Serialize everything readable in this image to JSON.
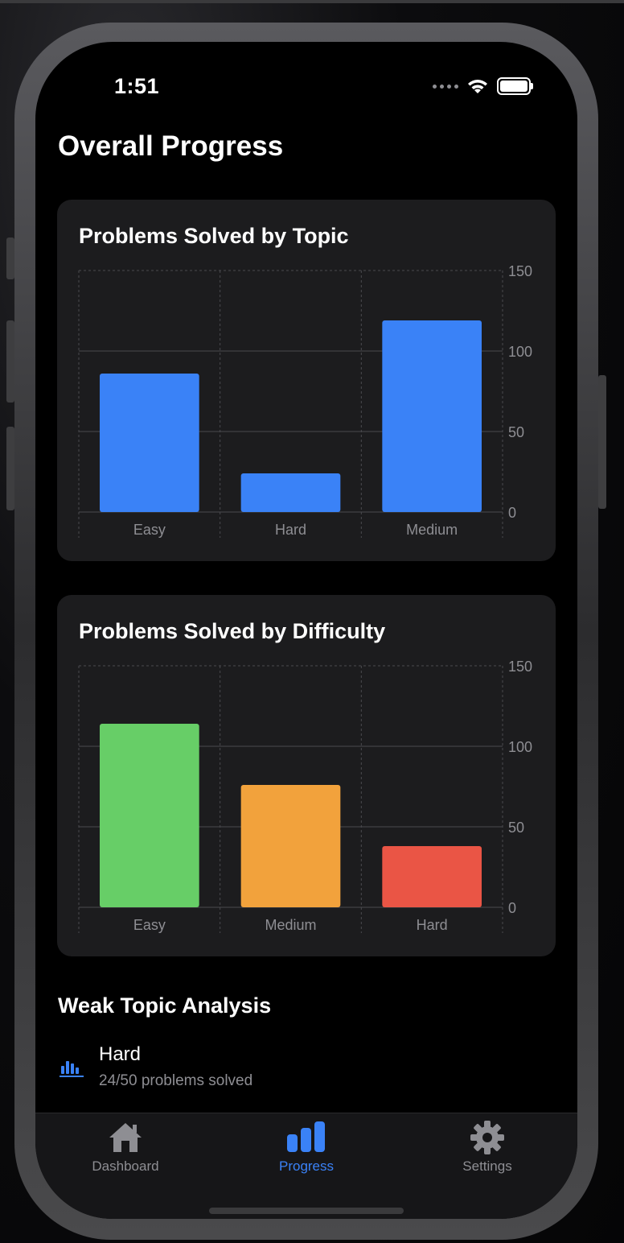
{
  "status_bar": {
    "time": "1:51"
  },
  "page_title": "Overall Progress",
  "topic_card": {
    "title": "Problems Solved by Topic"
  },
  "difficulty_card": {
    "title": "Problems Solved by Difficulty"
  },
  "chart_data": [
    {
      "type": "bar",
      "title": "Problems Solved by Topic",
      "categories": [
        "Easy",
        "Hard",
        "Medium"
      ],
      "values": [
        86,
        24,
        119
      ],
      "colors": [
        "#3a82f7",
        "#3a82f7",
        "#3a82f7"
      ],
      "ylim": [
        0,
        150
      ],
      "yticks": [
        0,
        50,
        100,
        150
      ],
      "y_axis_side": "right",
      "grid": true
    },
    {
      "type": "bar",
      "title": "Problems Solved by Difficulty",
      "categories": [
        "Easy",
        "Medium",
        "Hard"
      ],
      "values": [
        114,
        76,
        38
      ],
      "colors": [
        "#67ce67",
        "#f2a23c",
        "#ea5545"
      ],
      "ylim": [
        0,
        150
      ],
      "yticks": [
        0,
        50,
        100,
        150
      ],
      "y_axis_side": "right",
      "grid": true
    }
  ],
  "weak_topics": {
    "title": "Weak Topic Analysis",
    "items": [
      {
        "topic": "Hard",
        "detail": "24/50 problems solved",
        "icon": "chart-bar-icon"
      }
    ]
  },
  "tab_bar": {
    "tabs": [
      {
        "label": "Dashboard",
        "icon": "house-icon",
        "active": false
      },
      {
        "label": "Progress",
        "icon": "chart-bar-icon",
        "active": true
      },
      {
        "label": "Settings",
        "icon": "gear-icon",
        "active": false
      }
    ]
  },
  "colors": {
    "accent": "#3a82f7",
    "card_background": "#1c1c1e",
    "secondary_text": "#8e8e93"
  }
}
